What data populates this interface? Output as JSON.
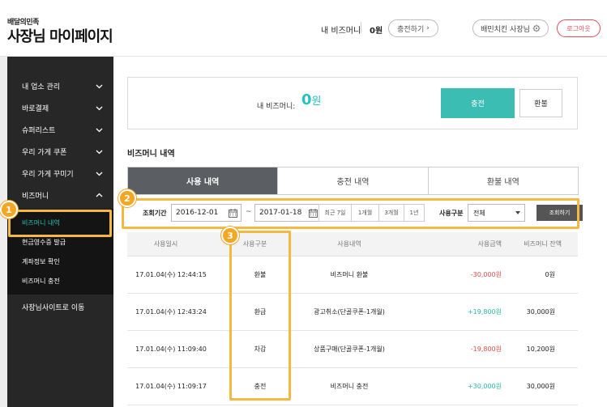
{
  "header": {
    "logo_small": "배달의민족",
    "logo_title": "사장님 마이페이지",
    "money_label": "내 비즈머니",
    "money_value": "0원",
    "charge_button": "충전하기",
    "owner_button": "배민치킨 사장님",
    "logout_button": "로그아웃"
  },
  "sidebar": {
    "items": [
      {
        "label": "내 업소 관리",
        "chevron": "down"
      },
      {
        "label": "바로결제",
        "chevron": "down"
      },
      {
        "label": "슈퍼리스트",
        "chevron": "down"
      },
      {
        "label": "우리 가게 쿠폰",
        "chevron": "down"
      },
      {
        "label": "우리 가게 꾸미기",
        "chevron": "down"
      },
      {
        "label": "비즈머니",
        "chevron": "up"
      }
    ],
    "sub_items": [
      {
        "label": "비즈머니 내역",
        "active": true
      },
      {
        "label": "현금영수증 발급",
        "active": false
      },
      {
        "label": "계좌정보 확인",
        "active": false
      },
      {
        "label": "비즈머니 충전",
        "active": false
      }
    ],
    "footer_link": "사장님사이트로 이동"
  },
  "money_box": {
    "label": "내 비즈머니:",
    "value": "0",
    "unit": "원",
    "charge_label": "충전",
    "refund_label": "환불"
  },
  "section_title": "비즈머니 내역",
  "tabs": [
    {
      "label": "사용 내역",
      "active": true
    },
    {
      "label": "충전 내역",
      "active": false
    },
    {
      "label": "환불 내역",
      "active": false
    }
  ],
  "filter": {
    "period_label": "조회기간",
    "date_from": "2016-12-01",
    "date_to": "2017-01-18",
    "tilde": "~",
    "periods": [
      "최근 7일",
      "1개월",
      "3개월",
      "1년"
    ],
    "type_label": "사용구분",
    "type_value": "전체",
    "search_label": "조회하기"
  },
  "table": {
    "headers": [
      "사용일시",
      "사용구분",
      "사용내역",
      "사용금액",
      "비즈머니 잔액"
    ],
    "rows": [
      {
        "date": "17.01.04(수) 12:44:15",
        "type": "환불",
        "desc": "비즈머니 환불",
        "amount": "-30,000원",
        "balance": "0원",
        "sign": "neg"
      },
      {
        "date": "17.01.04(수) 12:43:24",
        "type": "환급",
        "desc": "광고취소(단골쿠폰-1개월)",
        "amount": "+19,800원",
        "balance": "30,000원",
        "sign": "pos"
      },
      {
        "date": "17.01.04(수) 11:09:40",
        "type": "차감",
        "desc": "상품구매(단골쿠폰-1개월)",
        "amount": "-19,800원",
        "balance": "10,200원",
        "sign": "neg"
      },
      {
        "date": "17.01.04(수) 11:09:17",
        "type": "충전",
        "desc": "비즈머니 충전",
        "amount": "+30,000원",
        "balance": "30,000원",
        "sign": "pos"
      }
    ]
  },
  "annotations": {
    "badge1": "1",
    "badge2": "2",
    "badge3": "3"
  },
  "colors": {
    "accent": "#2ac1bc",
    "highlight": "#f5b941",
    "negative": "#e24b4b",
    "positive": "#2ab7a8"
  }
}
